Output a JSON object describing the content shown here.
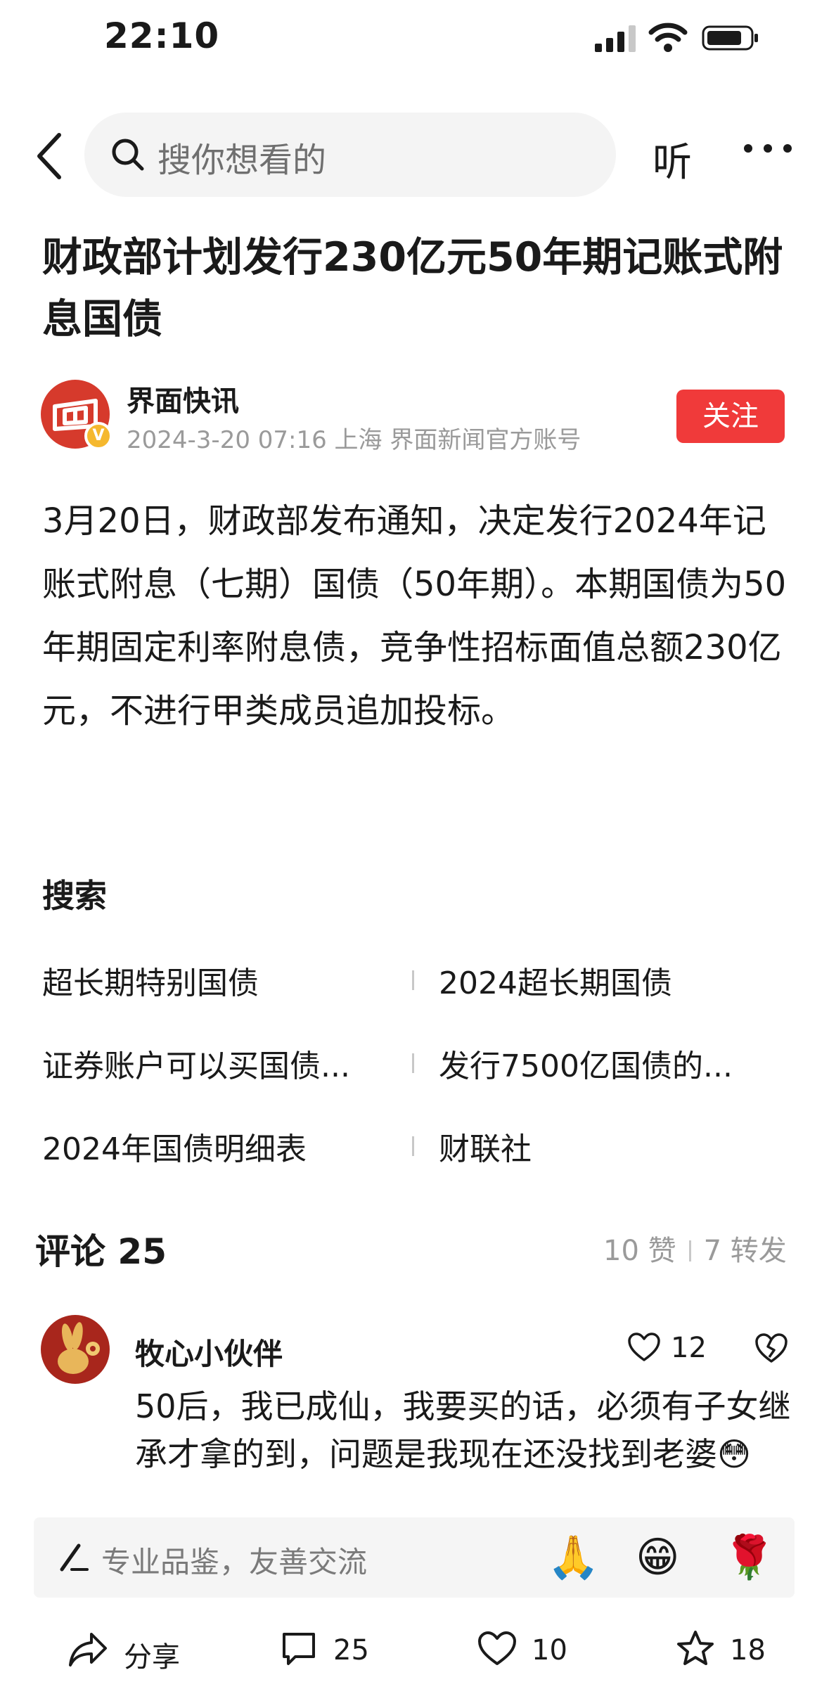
{
  "status_bar": {
    "time": "22:10"
  },
  "nav": {
    "search_placeholder": "搜你想看的",
    "listen_label": "听"
  },
  "article": {
    "title": "财政部计划发行230亿元50年期记账式附息国债",
    "author": {
      "name": "界面快讯",
      "meta": "2024-3-20  07:16  上海  界面新闻官方账号",
      "verified_mark": "V"
    },
    "follow_label": "关注",
    "body": "3月20日，财政部发布通知，决定发行2024年记账式附息（七期）国债（50年期）。本期国债为50年期固定利率附息债，竞争性招标面值总额230亿元，不进行甲类成员追加投标。"
  },
  "search_section": {
    "heading": "搜索",
    "items": [
      "超长期特别国债",
      "2024超长期国债",
      "证券账户可以买国债...",
      "发行7500亿国债的...",
      "2024年国债明细表",
      "财联社"
    ]
  },
  "comments": {
    "heading": "评论 25",
    "likes": "10 赞",
    "reposts": "7 转发",
    "items": [
      {
        "user": "牧心小伙伴",
        "like_count": "12",
        "text": "50后，我已成仙，我要买的话，必须有子女继承才拿的到，问题是我现在还没找到老婆😳"
      }
    ]
  },
  "comment_bar": {
    "placeholder": "专业品鉴，友善交流",
    "emojis": [
      "🙏",
      "😁",
      "🌹"
    ]
  },
  "bottom_bar": {
    "share_label": "分享",
    "comment_count": "25",
    "like_count": "10",
    "favorite_count": "18"
  },
  "colors": {
    "accent_red": "#f03a3a",
    "muted_gray": "#9a9a9a",
    "search_bg": "#f4f4f4"
  }
}
